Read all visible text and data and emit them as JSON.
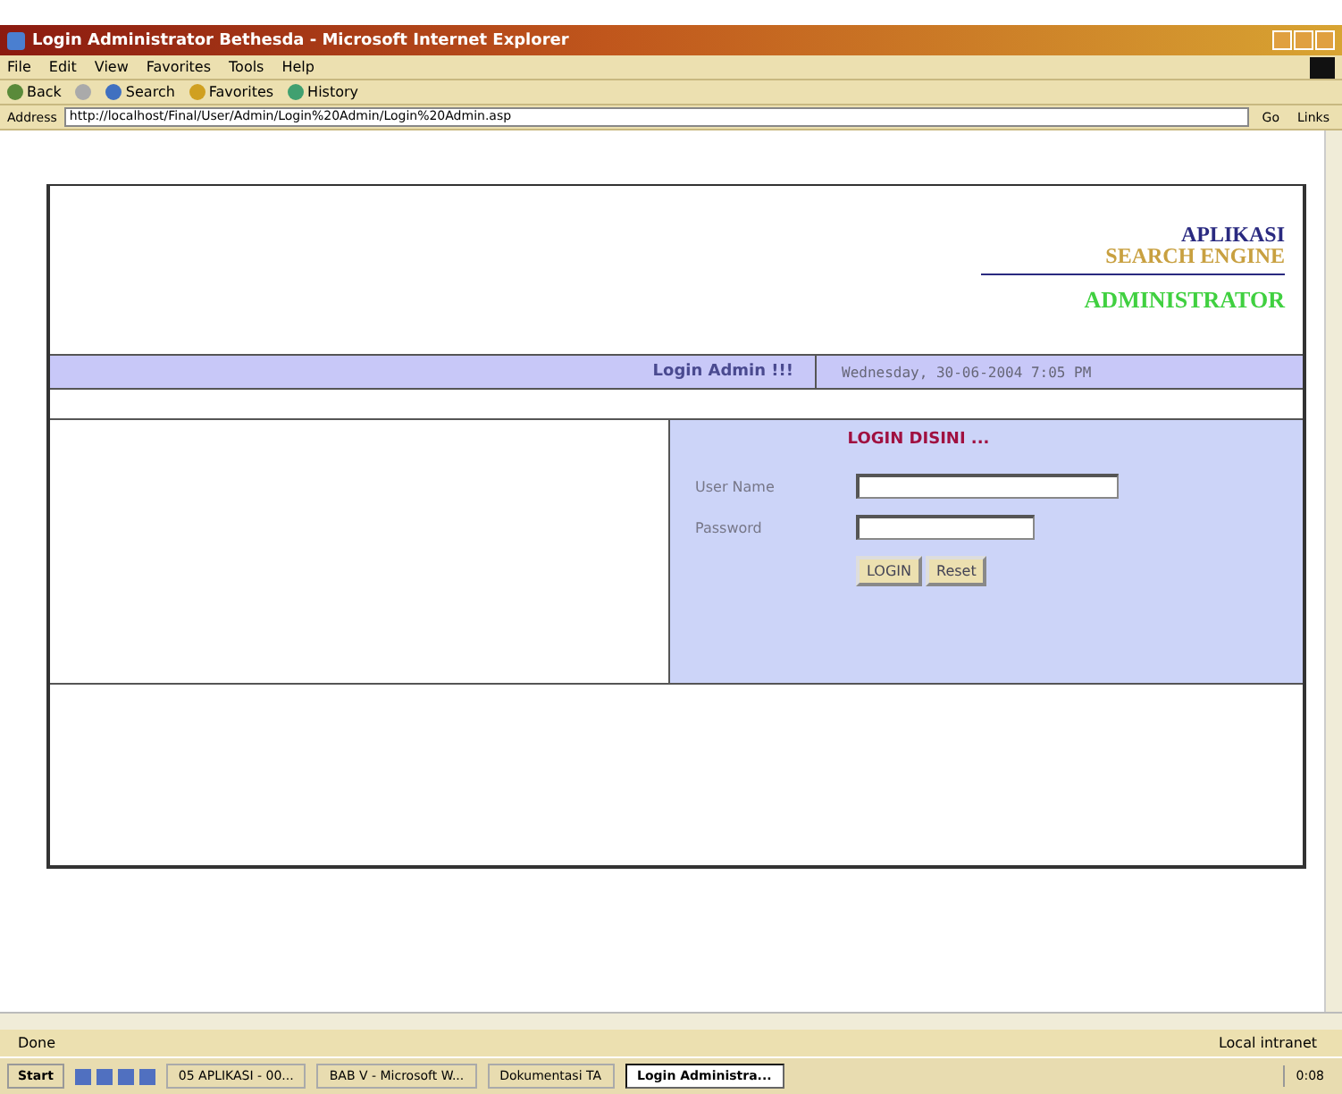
{
  "window": {
    "title": "Login Administrator Bethesda - Microsoft Internet Explorer"
  },
  "menu": [
    "File",
    "Edit",
    "View",
    "Favorites",
    "Tools",
    "Help"
  ],
  "toolbar": [
    {
      "kind": "back",
      "label": "Back"
    },
    {
      "kind": "stop"
    },
    {
      "kind": "search",
      "label": "Search"
    },
    {
      "kind": "favorites",
      "label": "Favorites"
    },
    {
      "kind": "history",
      "label": "History"
    }
  ],
  "address": {
    "label": "Address",
    "value": "http://localhost/Final/User/Admin/Login%20Admin/Login%20Admin.asp",
    "go": "Go",
    "links": "Links"
  },
  "header": {
    "line1": "APLIKASI",
    "line2": "SEARCH ENGINE",
    "line3": "ADMINISTRATOR"
  },
  "info_bar": {
    "heading": "Login Admin !!!",
    "date": "Wednesday, 30-06-2004 7:05 PM"
  },
  "login": {
    "title": "LOGIN DISINI ...",
    "fields": [
      {
        "label": "User Name"
      },
      {
        "label": "Password"
      }
    ],
    "buttons": [
      "LOGIN",
      "Reset"
    ]
  },
  "status_bar": {
    "text": "Done",
    "zone": "Local intranet"
  },
  "taskbar": {
    "start": "Start",
    "tasks": [
      {
        "label": "05 APLIKASI - 00...",
        "selected": false
      },
      {
        "label": "BAB V - Microsoft W...",
        "selected": false
      },
      {
        "label": "Dokumentasi TA",
        "selected": false
      },
      {
        "label": "Login Administra...",
        "selected": true
      }
    ],
    "clock": "0:08"
  }
}
